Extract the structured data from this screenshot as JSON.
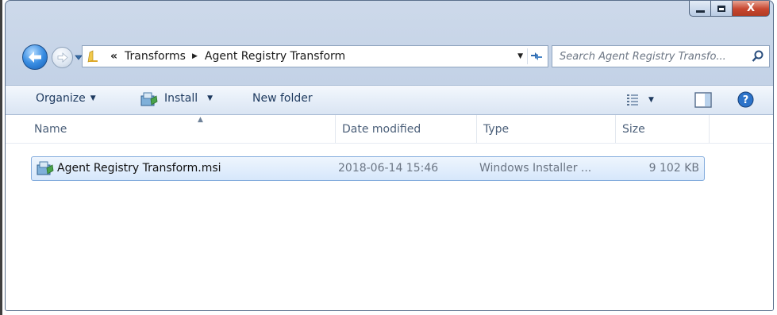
{
  "window": {
    "close_glyph": "X",
    "icons": {
      "minimize": "minimize-icon",
      "maximize": "maximize-icon",
      "close": "close-icon"
    }
  },
  "nav": {
    "back_icon": "back-arrow-icon",
    "forward_icon": "forward-arrow-icon",
    "overflow_chevron": "«",
    "breadcrumbs": [
      "Transforms",
      "Agent Registry Transform"
    ],
    "search_placeholder": "Search Agent Registry Transfo...",
    "colors": {
      "back_button": "#2f7fd8"
    }
  },
  "toolbar": {
    "organize": "Organize",
    "install": "Install",
    "new_folder": "New folder"
  },
  "columns": [
    "Name",
    "Date modified",
    "Type",
    "Size"
  ],
  "files": [
    {
      "name": "Agent Registry Transform.msi",
      "date_modified": "2018-06-14 15:46",
      "type": "Windows Installer ...",
      "size": "9 102 KB",
      "selected": true
    }
  ],
  "colors": {
    "selection": "#cce4fb",
    "selection_border": "#84acdd",
    "toolbar_text": "#1e3a5f"
  }
}
